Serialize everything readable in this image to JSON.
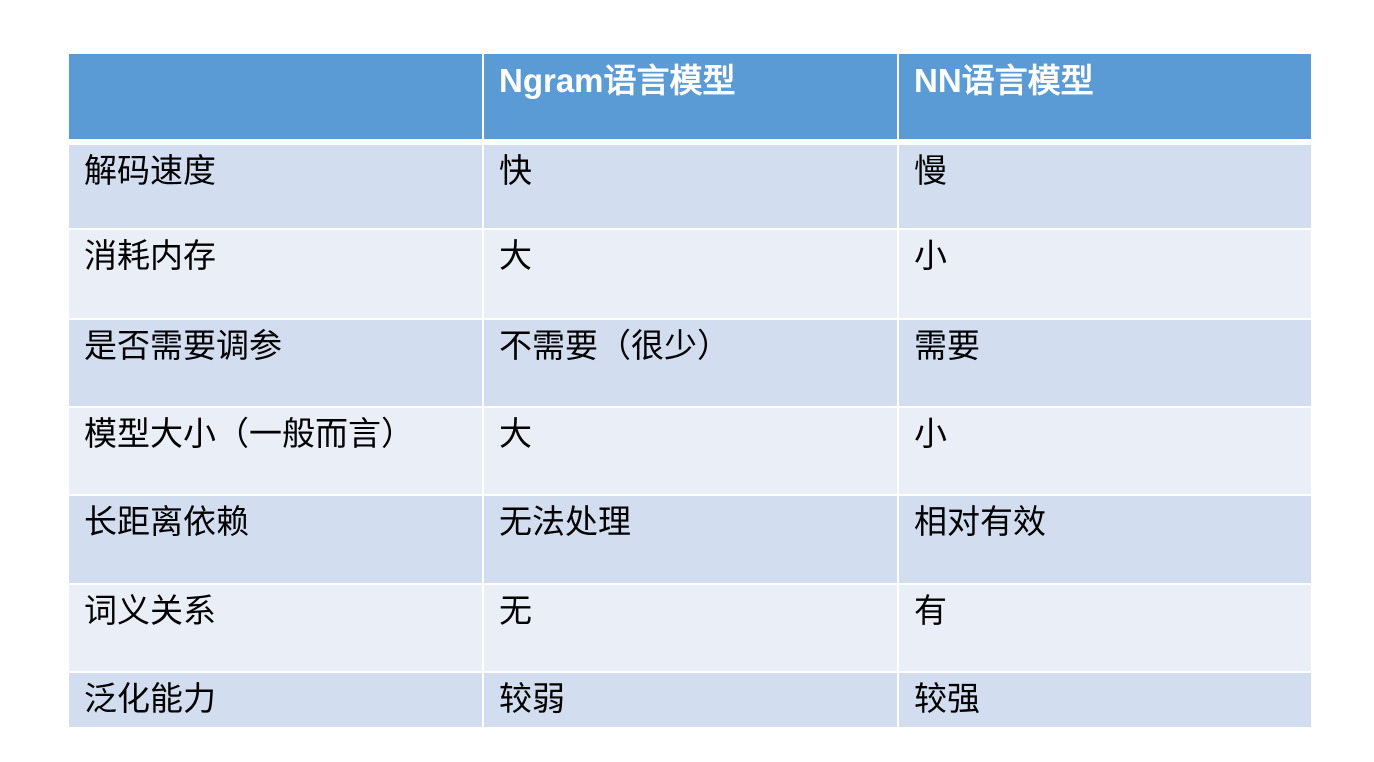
{
  "table": {
    "headers": [
      "Ngram语言模型",
      "NN语言模型"
    ],
    "rows": [
      [
        "解码速度",
        "快",
        "慢"
      ],
      [
        "消耗内存",
        "大",
        "小"
      ],
      [
        "是否需要调参",
        "不需要（很少）",
        "需要"
      ],
      [
        "模型大小（一般而言）",
        "大",
        "小"
      ],
      [
        "长距离依赖",
        "无法处理",
        "相对有效"
      ],
      [
        "词义关系",
        "无",
        "有"
      ],
      [
        "泛化能力",
        "较弱",
        "较强"
      ]
    ]
  },
  "colors": {
    "header_bg": "#5B9BD5",
    "row_odd": "#D2DEEF",
    "row_even": "#EAEFF7",
    "page_bg": "#FFFFFF"
  }
}
